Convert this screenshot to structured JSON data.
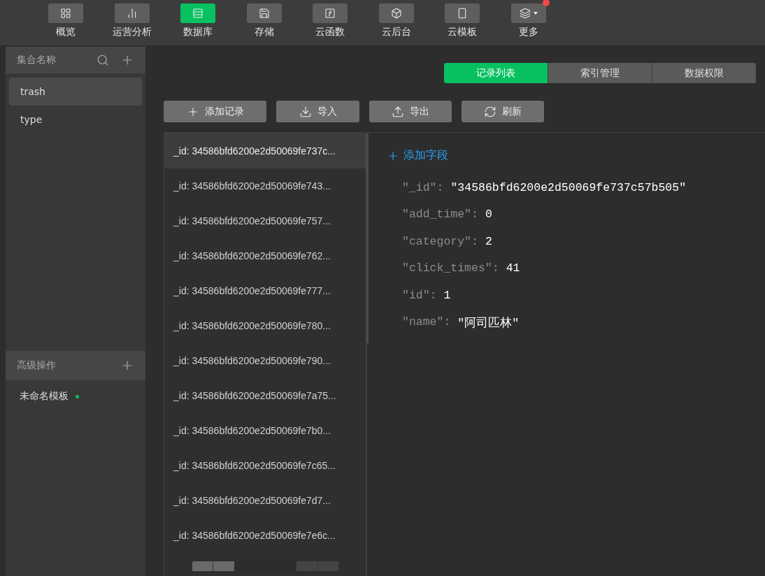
{
  "toolbar": [
    {
      "label": "概览",
      "selected": false,
      "dot": false
    },
    {
      "label": "运营分析",
      "selected": false,
      "dot": false
    },
    {
      "label": "数据库",
      "selected": true,
      "dot": false
    },
    {
      "label": "存储",
      "selected": false,
      "dot": false
    },
    {
      "label": "云函数",
      "selected": false,
      "dot": false
    },
    {
      "label": "云后台",
      "selected": false,
      "dot": false
    },
    {
      "label": "云模板",
      "selected": false,
      "dot": false
    },
    {
      "label": "更多",
      "selected": false,
      "dot": true
    }
  ],
  "sidebar": {
    "collections_header": "集合名称",
    "collections": [
      {
        "label": "trash",
        "selected": true
      },
      {
        "label": "type",
        "selected": false
      }
    ],
    "advanced_header": "高级操作",
    "templates": [
      {
        "label": "未命名模板",
        "color": "#07c160"
      }
    ]
  },
  "tabs": [
    {
      "label": "记录列表",
      "selected": true
    },
    {
      "label": "索引管理",
      "selected": false
    },
    {
      "label": "数据权限",
      "selected": false
    }
  ],
  "actions": [
    {
      "label": "添加记录"
    },
    {
      "label": "导入"
    },
    {
      "label": "导出"
    },
    {
      "label": "刷新"
    }
  ],
  "records": [
    {
      "label": "_id: 34586bfd6200e2d50069fe737c...",
      "selected": true
    },
    {
      "label": "_id: 34586bfd6200e2d50069fe743...",
      "selected": false
    },
    {
      "label": "_id: 34586bfd6200e2d50069fe757...",
      "selected": false
    },
    {
      "label": "_id: 34586bfd6200e2d50069fe762...",
      "selected": false
    },
    {
      "label": "_id: 34586bfd6200e2d50069fe777...",
      "selected": false
    },
    {
      "label": "_id: 34586bfd6200e2d50069fe780...",
      "selected": false
    },
    {
      "label": "_id: 34586bfd6200e2d50069fe790...",
      "selected": false
    },
    {
      "label": "_id: 34586bfd6200e2d50069fe7a75...",
      "selected": false
    },
    {
      "label": "_id: 34586bfd6200e2d50069fe7b0...",
      "selected": false
    },
    {
      "label": "_id: 34586bfd6200e2d50069fe7c65...",
      "selected": false
    },
    {
      "label": "_id: 34586bfd6200e2d50069fe7d7...",
      "selected": false
    },
    {
      "label": "_id: 34586bfd6200e2d50069fe7e6c...",
      "selected": false
    }
  ],
  "detail": {
    "add_field": "添加字段",
    "fields": [
      {
        "key": "\"_id\":",
        "value": "\"34586bfd6200e2d50069fe737c57b505\""
      },
      {
        "key": "\"add_time\":",
        "value": "0"
      },
      {
        "key": "\"category\":",
        "value": "2"
      },
      {
        "key": "\"click_times\":",
        "value": "41"
      },
      {
        "key": "\"id\":",
        "value": "1"
      },
      {
        "key": "\"name\":",
        "value": "\"阿司匹林\""
      }
    ]
  }
}
